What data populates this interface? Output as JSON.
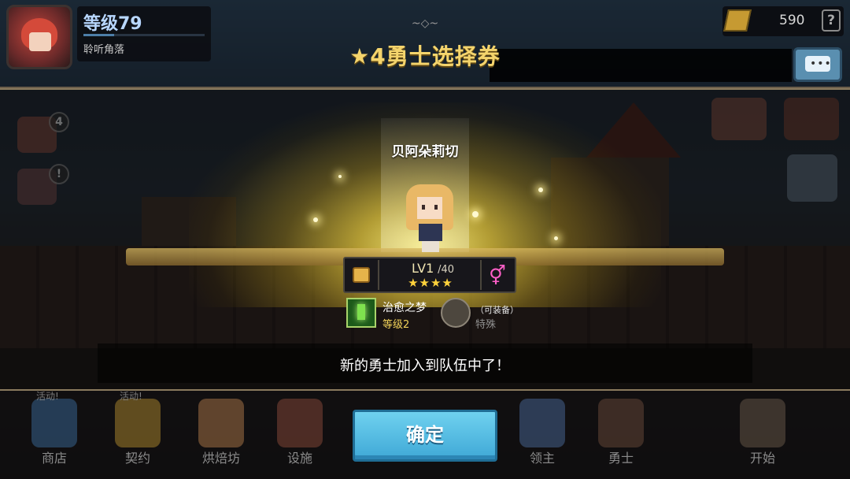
{
  "header": {
    "title": "★4勇士选择券",
    "player": {
      "level_text": "等级79",
      "title_text": "聆听角落",
      "xp_fraction": 0.25
    },
    "currency": {
      "value": "590",
      "help": "?"
    }
  },
  "side_badges": {
    "mail": "4",
    "quest": "!"
  },
  "reveal": {
    "hero_name": "贝阿朵莉切",
    "level": "LV1",
    "level_max": "/40",
    "stars": "★★★★",
    "star_count": 4,
    "gender_symbol": "⚥",
    "skill": {
      "name": "治愈之梦",
      "level": "等级2"
    },
    "equip": {
      "label": "（可装备）",
      "type": "特殊"
    },
    "message": "新的勇士加入到队伍中了！"
  },
  "confirm_label": "确定",
  "bottom_nav": [
    {
      "label": "商店",
      "tag": "活动!"
    },
    {
      "label": "契约",
      "tag": "活动!"
    },
    {
      "label": "烘焙坊",
      "tag": ""
    },
    {
      "label": "设施",
      "tag": ""
    },
    {
      "label": "领主",
      "tag": ""
    },
    {
      "label": "勇士",
      "tag": ""
    },
    {
      "label": "开始",
      "tag": ""
    }
  ],
  "colors": {
    "title_gold": "#f4d46c",
    "confirm_blue": "#4fbce3",
    "skill_level_yellow": "#f2d35a",
    "gender_pink": "#ff5fc8"
  }
}
